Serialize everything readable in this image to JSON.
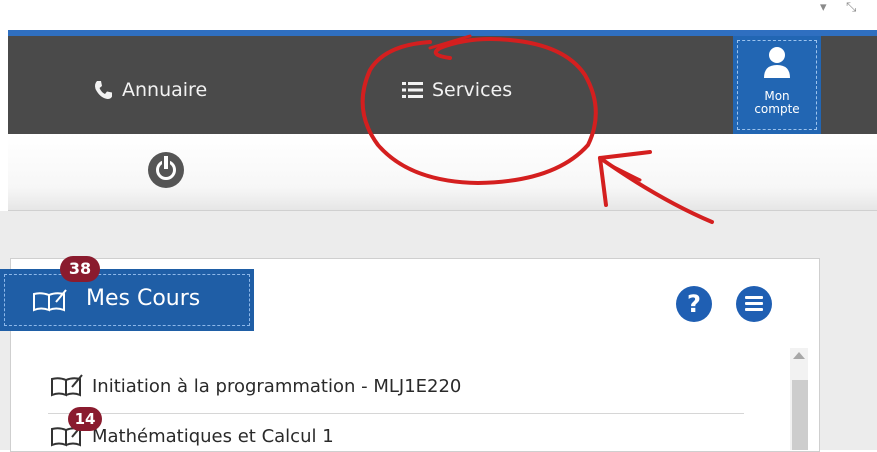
{
  "nav": {
    "directory_label": "Annuaire",
    "services_label": "Services",
    "account_label_line1": "Mon",
    "account_label_line2": "compte"
  },
  "courses_panel": {
    "title": "Mes Cours",
    "badge_count": "38",
    "help_label": "?",
    "courses": [
      {
        "name": "Initiation à la programmation - MLJ1E220"
      },
      {
        "name": "Mathématiques et Calcul 1",
        "badge": "14"
      }
    ]
  },
  "colors": {
    "nav_bg": "#4a4a4a",
    "accent_blue": "#1f5ea6",
    "badge_red": "#8a1b2e",
    "annotation_red": "#d41f1f"
  },
  "icons": {
    "directory": "phone-icon",
    "services": "list-icon",
    "account": "user-icon",
    "logout": "power-icon",
    "courses": "book-icon",
    "help": "help-icon",
    "menu": "menu-icon"
  }
}
